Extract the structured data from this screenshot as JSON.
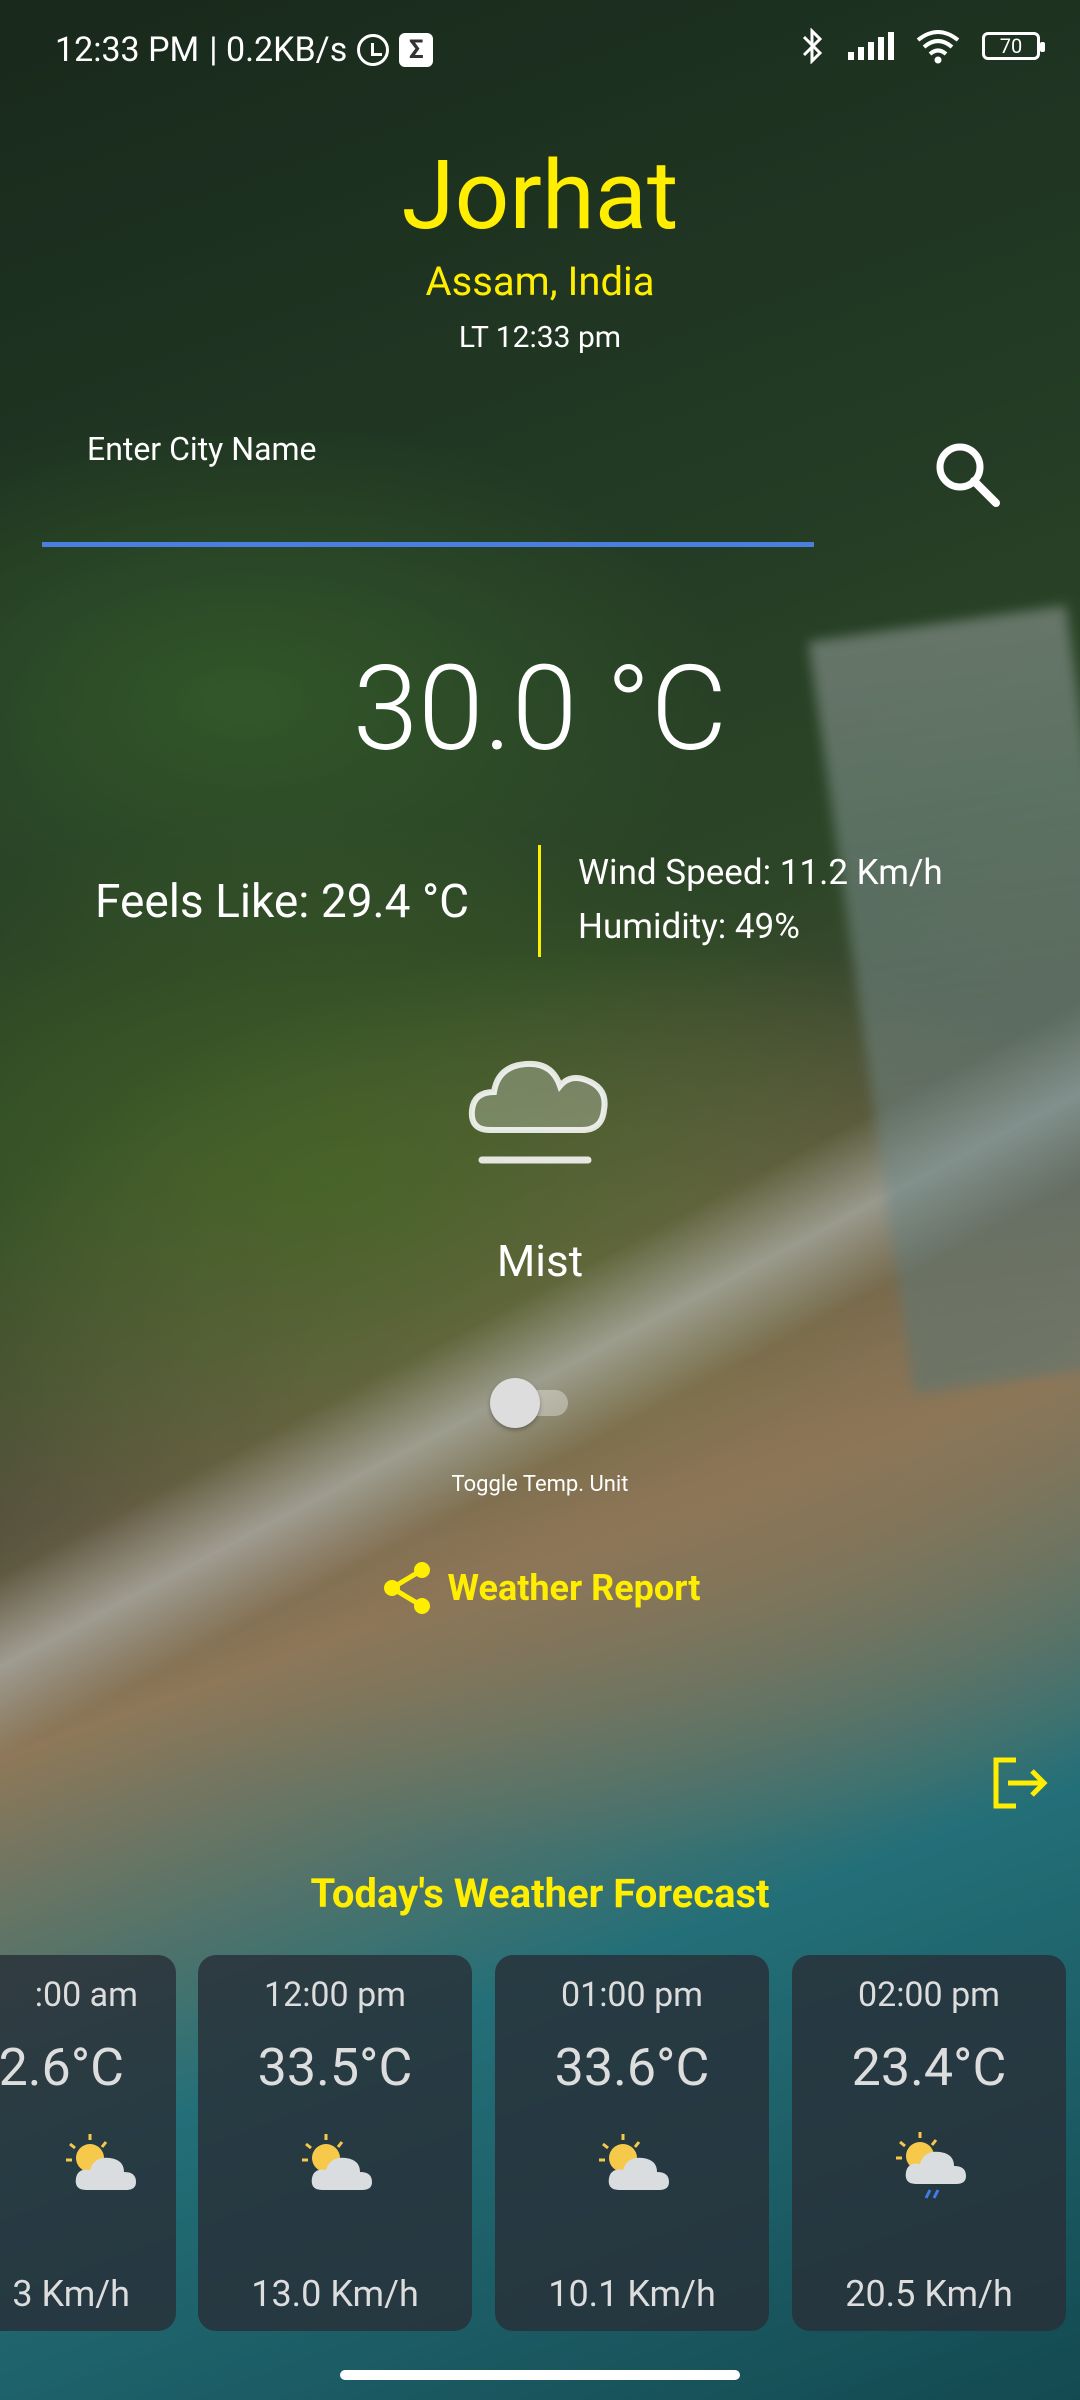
{
  "status_bar": {
    "time": "12:33 PM",
    "network_speed": "| 0.2KB/s",
    "sigma_glyph": "Σ",
    "battery": "70",
    "icons": [
      "alarm-icon",
      "sigma-app-icon",
      "bluetooth-icon",
      "signal-icon",
      "wifi-icon",
      "battery-icon"
    ]
  },
  "location": {
    "city": "Jorhat",
    "region": "Assam, India",
    "local_time": "LT 12:33 pm"
  },
  "search": {
    "label": "Enter City Name",
    "value": "",
    "icon": "search-icon"
  },
  "current": {
    "temperature": "30.0 °C",
    "feels_like": "Feels Like: 29.4 °C",
    "wind_speed": "Wind Speed: 11.2 Km/h",
    "humidity": "Humidity: 49%",
    "condition": "Mist",
    "condition_icon": "mist-cloud-icon"
  },
  "toggle": {
    "label": "Toggle Temp. Unit",
    "on": false
  },
  "report": {
    "label": "Weather Report",
    "icon": "share-icon"
  },
  "logout_icon": "logout-icon",
  "forecast": {
    "title": "Today's Weather Forecast",
    "items": [
      {
        "time": ":00 am",
        "temp": "2.6°C",
        "wind": "3 Km/h",
        "icon": "partly-cloudy-icon"
      },
      {
        "time": "12:00 pm",
        "temp": "33.5°C",
        "wind": "13.0 Km/h",
        "icon": "partly-cloudy-icon"
      },
      {
        "time": "01:00 pm",
        "temp": "33.6°C",
        "wind": "10.1 Km/h",
        "icon": "partly-cloudy-icon"
      },
      {
        "time": "02:00 pm",
        "temp": "23.4°C",
        "wind": "20.5 Km/h",
        "icon": "partly-cloudy-rain-icon"
      }
    ]
  },
  "colors": {
    "accent_yellow": "#ffee00",
    "input_underline": "#4a7fe0",
    "card_bg": "#283038"
  }
}
